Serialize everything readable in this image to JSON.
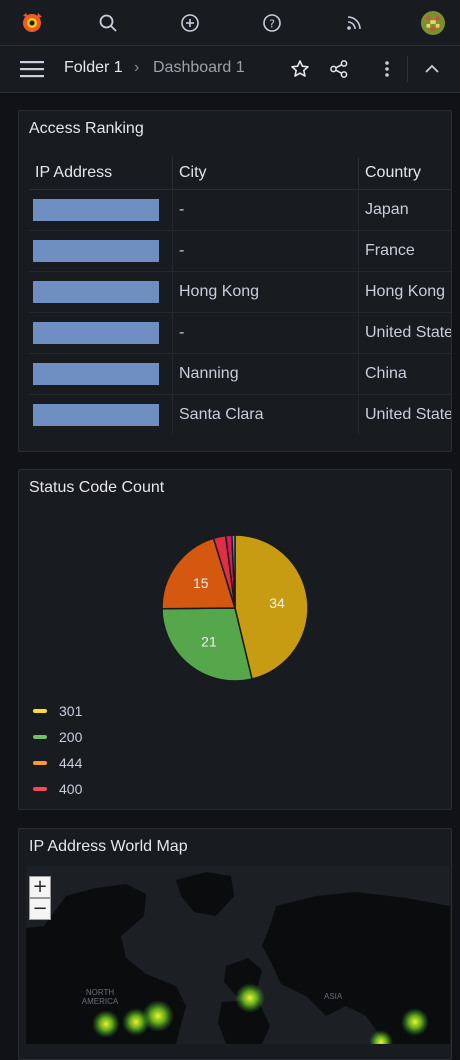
{
  "topnav": {
    "icons": [
      "grafana-logo-icon",
      "search-icon",
      "plus-circle-icon",
      "help-icon",
      "rss-icon",
      "user-avatar"
    ]
  },
  "breadcrumb": {
    "folder": "Folder 1",
    "separator": "›",
    "dashboard": "Dashboard 1"
  },
  "access_panel": {
    "title": "Access Ranking",
    "headers": [
      "IP Address",
      "City",
      "Country"
    ],
    "rows": [
      {
        "city": "-",
        "country": "Japan"
      },
      {
        "city": "-",
        "country": "France"
      },
      {
        "city": "Hong Kong",
        "country": "Hong Kong"
      },
      {
        "city": "-",
        "country": "United States"
      },
      {
        "city": "Nanning",
        "country": "China"
      },
      {
        "city": "Santa Clara",
        "country": "United States"
      }
    ]
  },
  "status_panel": {
    "title": "Status Code Count",
    "legend": [
      {
        "label": "301",
        "color": "#fade2a"
      },
      {
        "label": "200",
        "color": "#73bf69"
      },
      {
        "label": "444",
        "color": "#ff9830"
      },
      {
        "label": "400",
        "color": "#f2495c"
      }
    ]
  },
  "chart_data": {
    "type": "pie",
    "title": "Status Code Count",
    "slices": [
      {
        "label": "301",
        "value": 34,
        "color": "#c79b12"
      },
      {
        "label": "200",
        "value": 21,
        "color": "#56a64b"
      },
      {
        "label": "444",
        "value": 15,
        "color": "#d4580f"
      },
      {
        "label": "400",
        "value": 2,
        "color": "#e02f44"
      },
      {
        "label": "other",
        "value": 1,
        "color": "#e0185a"
      },
      {
        "label": "other",
        "value": 0.5,
        "color": "#5794f2"
      }
    ],
    "legend_position": "bottom-left"
  },
  "map_panel": {
    "title": "IP Address World Map",
    "zoom_in": "+",
    "zoom_out": "−",
    "labels": {
      "north_america": "NORTH AMERICA",
      "asia": "ASIA"
    }
  }
}
